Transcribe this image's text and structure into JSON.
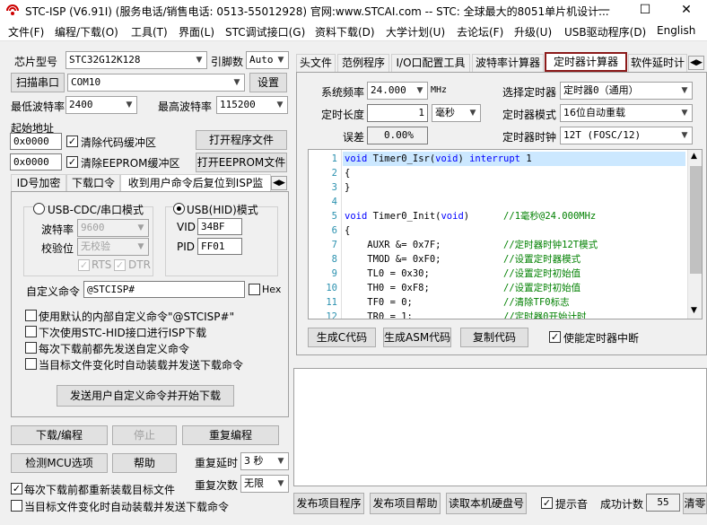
{
  "window": {
    "title": "STC-ISP (V6.91I) (服务电话/销售电话: 0513-55012928) 官网:www.STCAI.com  -- STC: 全球最大的8051单片机设计...",
    "minimize": "—",
    "maximize": "☐",
    "close": "✕"
  },
  "menu": [
    "文件(F)",
    "编程/下载(O)",
    "工具(T)",
    "界面(L)",
    "STC调试接口(G)",
    "资料下载(D)",
    "大学计划(U)",
    "去论坛(F)",
    "升级(U)",
    "USB驱动程序(D)",
    "English"
  ],
  "left": {
    "chip_label": "芯片型号",
    "chip_value": "STC32G12K128",
    "pin_label": "引脚数",
    "pin_value": "Auto",
    "scan_button": "扫描串口",
    "port_value": "COM10",
    "settings_button": "设置",
    "min_baud_label": "最低波特率",
    "min_baud_value": "2400",
    "max_baud_label": "最高波特率",
    "max_baud_value": "115200",
    "start_addr_label": "起始地址",
    "addr1": "0x0000",
    "clear_code_label": "清除代码缓冲区",
    "open_program_button": "打开程序文件",
    "addr2": "0x0000",
    "clear_eeprom_label": "清除EEPROM缓冲区",
    "open_eeprom_button": "打开EEPROM文件",
    "tabs": [
      "ID号加密",
      "下载口令",
      "收到用户命令后复位到ISP监"
    ],
    "usb_cdc_label": "USB-CDC/串口模式",
    "usb_hid_label": "USB(HID)模式",
    "baud_label": "波特率",
    "baud_value": "9600",
    "parity_label": "校验位",
    "parity_value": "无校验",
    "rts_label": "RTS",
    "dtr_label": "DTR",
    "vid_label": "VID",
    "vid_value": "34BF",
    "pid_label": "PID",
    "pid_value": "FF01",
    "custom_cmd_label": "自定义命令",
    "custom_cmd_value": "@STCISP#",
    "hex_label": "Hex",
    "opt1": "使用默认的内部自定义命令\"@STCISP#\"",
    "opt2": "下次使用STC-HID接口进行ISP下载",
    "opt3": "每次下载前都先发送自定义命令",
    "opt4": "当目标文件变化时自动装载并发送下载命令",
    "send_cmd_button": "发送用户自定义命令并开始下载",
    "download_button": "下载/编程",
    "stop_button": "停止",
    "reprogram_button": "重复编程",
    "detect_mcu_button": "检测MCU选项",
    "help_button": "帮助",
    "repeat_delay_label": "重复延时",
    "repeat_delay_value": "3 秒",
    "repeat_count_label": "重复次数",
    "repeat_count_value": "无限",
    "reload_label": "每次下载前都重新装载目标文件",
    "auto_load_label": "当目标文件变化时自动装载并发送下载命令"
  },
  "right": {
    "tabs": [
      "头文件",
      "范例程序",
      "I/O口配置工具",
      "波特率计算器",
      "定时器计算器",
      "软件延时计"
    ],
    "active_tab": "定时器计算器",
    "sysfreq_label": "系统频率",
    "sysfreq_value": "24.000",
    "sysfreq_unit": "MHz",
    "select_timer_label": "选择定时器",
    "select_timer_value": "定时器0（通用）",
    "timer_len_label": "定时长度",
    "timer_len_value": "1",
    "timer_len_unit": "毫秒",
    "timer_mode_label": "定时器模式",
    "timer_mode_value": "16位自动重载",
    "error_label": "误差",
    "error_value": "0.00%",
    "timer_clock_label": "定时器时钟",
    "timer_clock_value": "12T (FOSC/12)",
    "code_lines": [
      {
        "n": "1",
        "t": "void Timer0_Isr(void) interrupt 1"
      },
      {
        "n": "2",
        "t": "{"
      },
      {
        "n": "3",
        "t": "}"
      },
      {
        "n": "4",
        "t": ""
      },
      {
        "n": "5",
        "t": "void Timer0_Init(void)      //1毫秒@24.000MHz"
      },
      {
        "n": "6",
        "t": "{"
      },
      {
        "n": "7",
        "t": "    AUXR &= 0x7F;           //定时器时钟12T模式"
      },
      {
        "n": "8",
        "t": "    TMOD &= 0xF0;           //设置定时器模式"
      },
      {
        "n": "9",
        "t": "    TL0 = 0x30;             //设置定时初始值"
      },
      {
        "n": "10",
        "t": "    TH0 = 0xF8;             //设置定时初始值"
      },
      {
        "n": "11",
        "t": "    TF0 = 0;                //清除TF0标志"
      },
      {
        "n": "12",
        "t": "    TR0 = 1;                //定时器0开始计时"
      }
    ],
    "gen_c_button": "生成C代码",
    "gen_asm_button": "生成ASM代码",
    "copy_code_button": "复制代码",
    "enable_int_label": "使能定时器中断",
    "publish_program_button": "发布项目程序",
    "publish_help_button": "发布项目帮助",
    "read_disk_button": "读取本机硬盘号",
    "beep_label": "提示音",
    "success_count_label": "成功计数",
    "success_count_value": "55",
    "clear_button": "清零"
  },
  "colors": {
    "highlight_tab_border": "#8b1a1a",
    "line_highlight": "#cce8ff",
    "keyword": "#0000ff",
    "comment": "#008000"
  }
}
